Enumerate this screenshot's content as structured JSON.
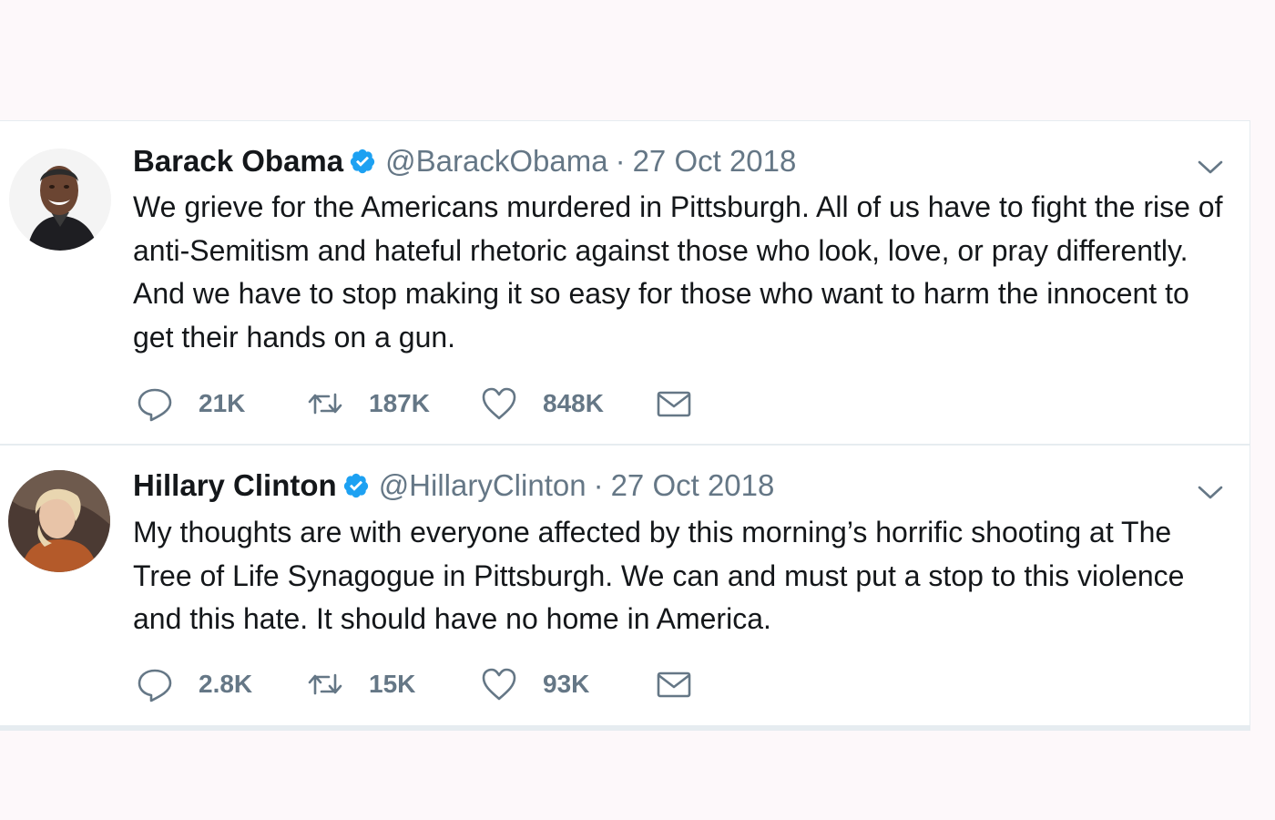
{
  "tweets": [
    {
      "name": "Barack Obama",
      "handle": "@BarackObama",
      "separator": "·",
      "date": "27 Oct 2018",
      "text": "We grieve for the Americans murdered in Pittsburgh. All of us have to fight the rise of anti-Semitism and hateful rhetoric against those who look, love, or pray differently. And we have to stop making it so easy for those who want to harm the innocent to get their hands on a gun.",
      "replies": "21K",
      "retweets": "187K",
      "likes": "848K"
    },
    {
      "name": "Hillary Clinton",
      "handle": "@HillaryClinton",
      "separator": "·",
      "date": "27 Oct 2018",
      "text": "My thoughts are with everyone affected by this morning’s horrific shooting at The Tree of Life Synagogue in Pittsburgh. We can and must put a stop to this violence and this hate. It should have no home in America.",
      "replies": "2.8K",
      "retweets": "15K",
      "likes": "93K"
    }
  ],
  "colors": {
    "verified": "#1da1f2",
    "secondary_text": "#657786",
    "primary_text": "#14171a",
    "divider": "#e6ecf0"
  },
  "icons": [
    "verified-badge-icon",
    "chevron-down-icon",
    "reply-icon",
    "retweet-icon",
    "like-icon",
    "direct-message-icon"
  ]
}
